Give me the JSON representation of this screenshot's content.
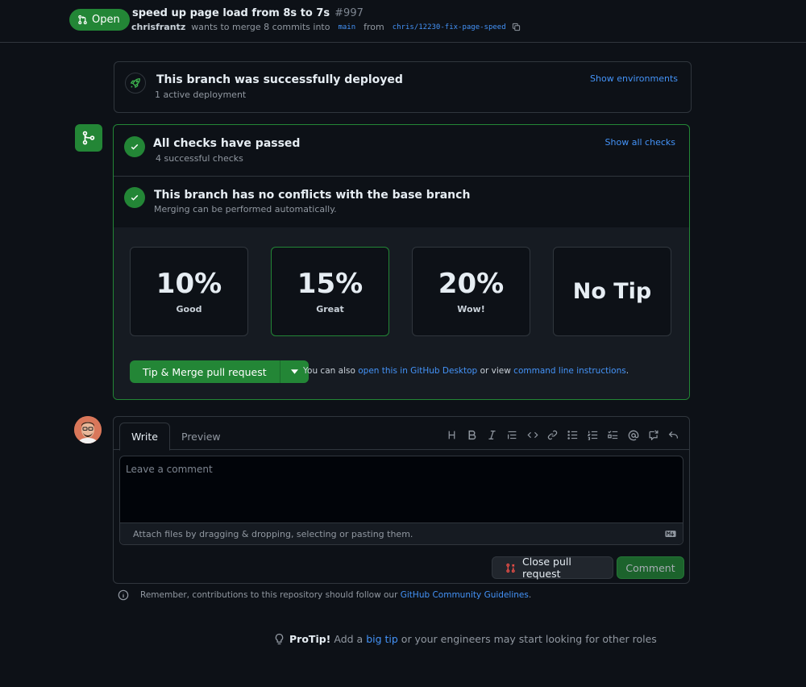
{
  "header": {
    "state_label": "Open",
    "title": "speed up page load from 8s to 7s",
    "number": "#997",
    "author": "chrisfrantz",
    "merge_text": "wants to merge 8 commits into",
    "base_branch": "main",
    "from_text": "from",
    "head_branch": "chris/12230-fix-page-speed"
  },
  "deployment": {
    "title": "This branch was successfully deployed",
    "subtitle": "1 active deployment",
    "link": "Show environments"
  },
  "checks": {
    "title": "All checks have passed",
    "subtitle": "4 successful checks",
    "link": "Show all checks"
  },
  "conflicts": {
    "title": "This branch has no conflicts with the base branch",
    "subtitle": "Merging can be performed automatically."
  },
  "tips": [
    {
      "value": "10%",
      "label": "Good",
      "selected": false
    },
    {
      "value": "15%",
      "label": "Great",
      "selected": true
    },
    {
      "value": "20%",
      "label": "Wow!",
      "selected": false
    },
    {
      "value": "No Tip",
      "label": "",
      "selected": false
    }
  ],
  "merge": {
    "button_label": "Tip & Merge pull request",
    "also_prefix": "You can also",
    "desktop_link": "open this in GitHub Desktop",
    "or_view": "or view",
    "cli_link": "command line instructions",
    "period": "."
  },
  "comment": {
    "tab_write": "Write",
    "tab_preview": "Preview",
    "placeholder": "Leave a comment",
    "attach_text": "Attach files by dragging & dropping, selecting or pasting them.",
    "close_button": "Close pull request",
    "comment_button": "Comment",
    "toolbar_icons": [
      "heading-icon",
      "bold-icon",
      "italic-icon",
      "quote-icon",
      "code-icon",
      "link-icon",
      "unordered-list-icon",
      "ordered-list-icon",
      "task-list-icon",
      "mention-icon",
      "cross-reference-icon",
      "reply-icon"
    ]
  },
  "guidelines": {
    "text": "Remember, contributions to this repository should follow our",
    "link": "GitHub Community Guidelines",
    "period": "."
  },
  "protip": {
    "label": "ProTip!",
    "text_before": "Add a",
    "link": "big tip",
    "text_after": "or your engineers may start looking for other roles"
  },
  "colors": {
    "background": "#0d1117",
    "success_green": "#238636",
    "link_blue": "#4493f8",
    "border": "#30363d",
    "danger_red": "#f85149"
  }
}
